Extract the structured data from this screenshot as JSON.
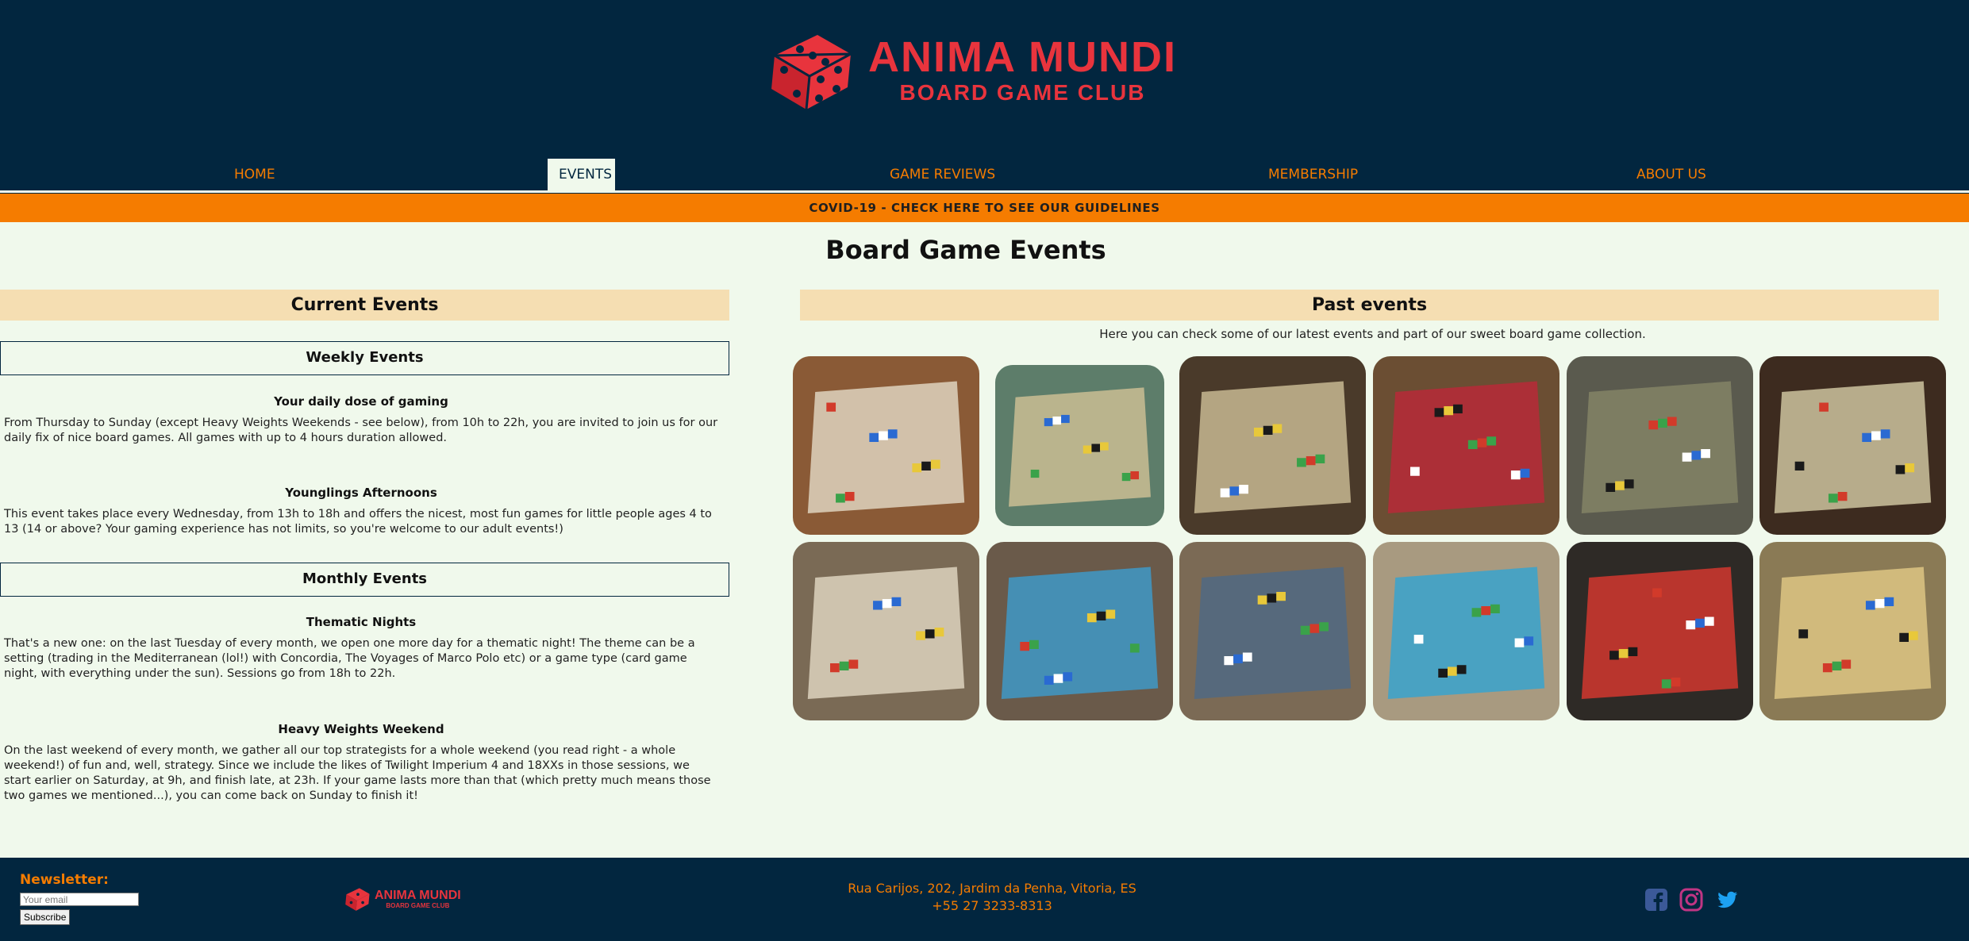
{
  "header": {
    "logo_title": "ANIMA MUNDI",
    "logo_subtitle": "BOARD GAME CLUB"
  },
  "nav": {
    "items": [
      {
        "label": "HOME",
        "active": false
      },
      {
        "label": "EVENTS",
        "active": true
      },
      {
        "label": "GAME REVIEWS",
        "active": false
      },
      {
        "label": "MEMBERSHIP",
        "active": false
      },
      {
        "label": "ABOUT US",
        "active": false
      }
    ]
  },
  "covid_banner": "COVID-19 - CHECK HERE TO SEE OUR GUIDELINES",
  "main": {
    "title": "Board Game Events",
    "current": {
      "heading": "Current Events",
      "weekly": {
        "heading": "Weekly Events",
        "events": [
          {
            "title": "Your daily dose of gaming",
            "text": "From Thursday to Sunday (except Heavy Weights Weekends - see below), from 10h to 22h, you are invited to join us for our daily fix of nice board games. All games with up to 4 hours duration allowed."
          },
          {
            "title": "Younglings Afternoons",
            "text": "This event takes place every Wednesday, from 13h to 18h and offers the nicest, most fun games for little people ages 4 to 13 (14 or above? Your gaming experience has not limits, so you're welcome to our adult events!)"
          }
        ]
      },
      "monthly": {
        "heading": "Monthly Events",
        "events": [
          {
            "title": "Thematic Nights",
            "text": "That's a new one: on the last Tuesday of every month, we open one more day for a thematic night! The theme can be a setting (trading in the Mediterranean (lol!) with Concordia, The Voyages of Marco Polo etc) or a game type (card game night, with everything under the sun). Sessions go from 18h to 22h."
          },
          {
            "title": "Heavy Weights Weekend",
            "text": "On the last weekend of every month, we gather all our top strategists for a whole weekend (you read right - a whole weekend!) of fun and, well, strategy. Since we include the likes of Twilight Imperium 4 and 18XXs in those sessions, we start earlier on Saturday, at 9h, and finish late, at 23h. If your game lasts more than that (which pretty much means those two games we mentioned...), you can come back on Sunday to finish it!"
          }
        ]
      }
    },
    "past": {
      "heading": "Past events",
      "intro": "Here you can check some of our latest events and part of our sweet board game collection.",
      "photos": [
        {
          "name": "photo-game-table-1",
          "bg": "#8a5a36",
          "accent": "#e9e4d2"
        },
        {
          "name": "photo-game-pieces-blur",
          "bg": "#5d7d6a",
          "accent": "#d9c79a"
        },
        {
          "name": "photo-map-board",
          "bg": "#4a3a2a",
          "accent": "#d8c9a0"
        },
        {
          "name": "photo-miniatures",
          "bg": "#6b4e33",
          "accent": "#c2253a"
        },
        {
          "name": "photo-dark-board",
          "bg": "#5a5a4e",
          "accent": "#8a8a6a"
        },
        {
          "name": "photo-colorful-board",
          "bg": "#3d2b1f",
          "accent": "#e0d8b0"
        },
        {
          "name": "photo-players-cards",
          "bg": "#7a6a55",
          "accent": "#ebe2cc"
        },
        {
          "name": "photo-blur-pieces",
          "bg": "#6a5a4a",
          "accent": "#3aa2d8"
        },
        {
          "name": "photo-big-board-room",
          "bg": "#7b6a55",
          "accent": "#4a6a8a"
        },
        {
          "name": "photo-train-pieces",
          "bg": "#a89a80",
          "accent": "#2aa4d8"
        },
        {
          "name": "photo-dice-meeples",
          "bg": "#2e2a26",
          "accent": "#e83a30"
        },
        {
          "name": "photo-board-close",
          "bg": "#8a7a55",
          "accent": "#e8d08a"
        }
      ]
    }
  },
  "footer": {
    "newsletter_label": "Newsletter:",
    "email_placeholder": "Your email",
    "subscribe_label": "Subscribe",
    "logo_title": "ANIMA MUNDI",
    "logo_subtitle": "BOARD GAME CLUB",
    "address": "Rua Carijos, 202, Jardim da Penha, Vitoria, ES",
    "phone": "+55 27 3233-8313",
    "social": [
      {
        "icon": "facebook-icon",
        "color": "#3b5998"
      },
      {
        "icon": "instagram-icon",
        "color": "#c13584"
      },
      {
        "icon": "twitter-icon",
        "color": "#1da1f2"
      }
    ]
  },
  "colors": {
    "header_bg": "#02263f",
    "accent_orange": "#f57c00",
    "brand_red": "#e8343d",
    "page_bg": "#f0f9ec",
    "band_bg": "#f5deb2"
  }
}
